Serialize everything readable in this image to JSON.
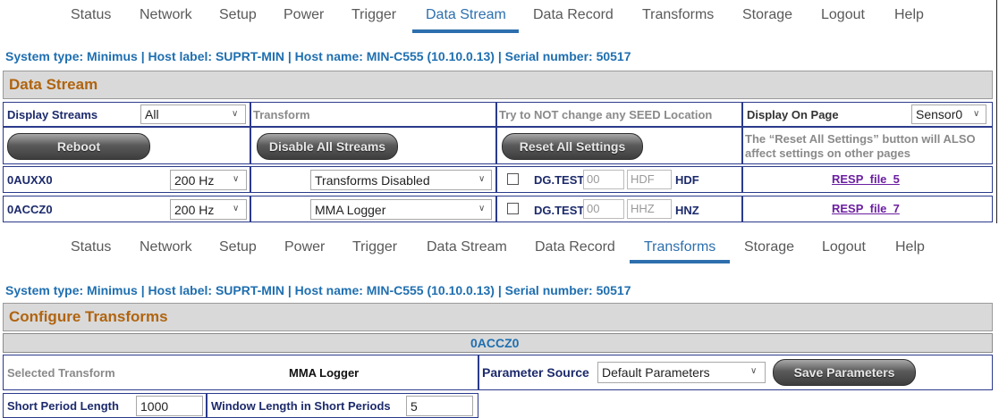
{
  "nav1": {
    "items": [
      "Status",
      "Network",
      "Setup",
      "Power",
      "Trigger",
      "Data Stream",
      "Data Record",
      "Transforms",
      "Storage",
      "Logout",
      "Help"
    ],
    "active": "Data Stream"
  },
  "nav2": {
    "items": [
      "Status",
      "Network",
      "Setup",
      "Power",
      "Trigger",
      "Data Stream",
      "Data Record",
      "Transforms",
      "Storage",
      "Logout",
      "Help"
    ],
    "active": "Transforms"
  },
  "sysinfo": "System type: Minimus | Host label: SUPRT-MIN | Host name: MIN-C555 (10.10.0.13) | Serial number: 50517",
  "datastream": {
    "title": "Data Stream",
    "display_streams_label": "Display Streams",
    "display_streams_value": "All",
    "transform_header": "Transform",
    "seed_header": "Try to NOT change any SEED Location",
    "display_on_page_label": "Display On Page",
    "display_on_page_value": "Sensor0",
    "reboot_label": "Reboot",
    "disable_all_label": "Disable All Streams",
    "reset_all_label": "Reset All Settings",
    "reset_note": "The “Reset All Settings” button will ALSO affect settings on other pages",
    "rows": [
      {
        "name": "0AUXX0",
        "rate": "200 Hz",
        "transform": "Transforms Disabled",
        "net": "DG.TEST.",
        "loc": "00",
        "chan": "HDF",
        "chan_bold": "HDF",
        "resp": "RESP_file_5"
      },
      {
        "name": "0ACCZ0",
        "rate": "200 Hz",
        "transform": "MMA Logger",
        "net": "DG.TEST.",
        "loc": "00",
        "chan": "HHZ",
        "chan_bold": "HNZ",
        "resp": "RESP_file_7"
      }
    ]
  },
  "transforms": {
    "title": "Configure Transforms",
    "channel": "0ACCZ0",
    "selected_label": "Selected Transform",
    "selected_value": "MMA Logger",
    "param_source_label": "Parameter Source",
    "param_source_value": "Default Parameters",
    "save_label": "Save Parameters",
    "short_period_label": "Short Period Length",
    "short_period_value": "1000",
    "window_label": "Window Length in Short Periods",
    "window_value": "5"
  },
  "colors": {
    "accent": "#2d6fae",
    "header_text": "#b0640f",
    "label_text": "#1c2a6b",
    "link": "#6b1fa0"
  }
}
